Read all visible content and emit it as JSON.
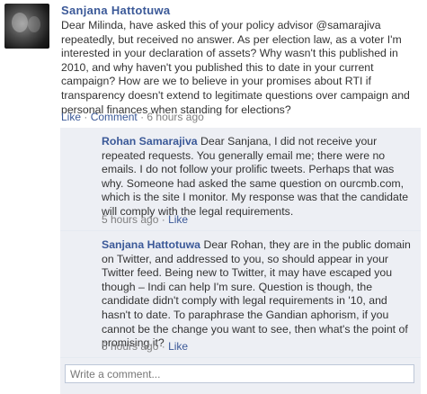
{
  "post": {
    "author": "Sanjana Hattotuwa",
    "body": "Dear Milinda, have asked this of your policy advisor @samarajiva repeatedly, but received no answer. As per election law, as a voter I'm interested in your declaration of assets? Why wasn't this published in 2010, and why haven't you published this to date in your current campaign? How are we to believe in your promises about RTI if transparency doesn't extend to legitimate questions over campaign and personal finances when standing for elections?",
    "like_label": "Like",
    "comment_label": "Comment",
    "separator": "·",
    "time": "6 hours ago"
  },
  "comments": [
    {
      "author": "Rohan Samarajiva",
      "text": "Dear Sanjana, I did not receive your repeated requests. You generally email me; there were no emails. I do not follow your prolific tweets. Perhaps that was why. Someone had asked the same question on ourcmb.com, which is the site I monitor. My response was that the candidate will comply with the legal requirements.",
      "time": "5 hours ago",
      "separator": "·",
      "like_label": "Like"
    },
    {
      "author": "Sanjana Hattotuwa",
      "text": "Dear Rohan, they are in the public domain on Twitter, and addressed to you, so should appear in your Twitter feed. Being new to Twitter, it may have escaped you though – Indi can help I'm sure. Question is though, the candidate didn't comply with legal requirements in '10, and hasn't to date. To paraphrase the Gandian aphorism, if you cannot be the change you want to see, then what's the point of promising it?",
      "time": "5 hours ago",
      "separator": "·",
      "like_label": "Like"
    }
  ],
  "composer": {
    "placeholder": "Write a comment..."
  },
  "colors": {
    "link": "#3b5998",
    "comment_bg": "#edeff4",
    "meta": "#808080",
    "input_border": "#bdc7d8"
  }
}
